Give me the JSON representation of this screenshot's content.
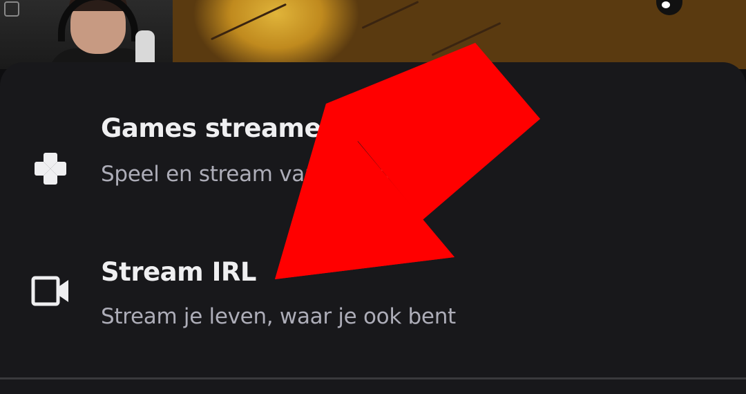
{
  "background": {
    "webcam": "webcam-overlay",
    "artwork": "stream-artwork"
  },
  "sheet": {
    "options": [
      {
        "icon": "gamepad-icon",
        "title": "Games streamen",
        "subtitle": "Speel en stream van je apparaat"
      },
      {
        "icon": "video-camera-icon",
        "title": "Stream IRL",
        "subtitle": "Stream je leven, waar je ook bent"
      }
    ]
  },
  "annotation": {
    "arrow_color": "#ff0000"
  },
  "colors": {
    "sheet_bg": "#18181b",
    "title": "#efeff1",
    "subtitle": "#adadb8"
  }
}
